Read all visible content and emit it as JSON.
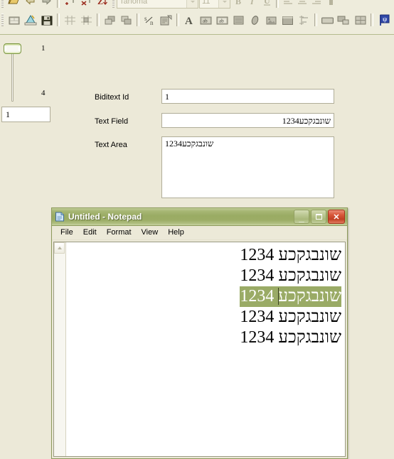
{
  "app_toolbar": {
    "font_name": "Tahoma",
    "font_size": "11",
    "top_row_icons": [
      "open-folder-icon",
      "undo-arrow-icon",
      "redo-arrow-icon",
      "insert-column-icon",
      "remove-column-icon",
      "sort-icon"
    ],
    "main_row_icons": [
      "properties-icon",
      "design-view-icon",
      "save-icon",
      "grid-icon",
      "snap-to-grid-icon",
      "bring-to-front-icon",
      "send-to-back-icon",
      "fraction-icon",
      "edit-mask-icon",
      "font-icon",
      "label-ab-icon",
      "textbox-ab-icon",
      "list-icon",
      "ellipse-icon",
      "image-icon",
      "panel-icon",
      "align-icon",
      "button-icon",
      "combo-icon",
      "table-icon",
      "flag-icon",
      "form-icon"
    ],
    "format_icons": [
      "bold-icon",
      "italic-icon",
      "underline-icon",
      "align-left-icon",
      "align-center-icon",
      "align-right-icon"
    ]
  },
  "designer": {
    "slider": {
      "name": "vertical-slider",
      "tick_top": "1",
      "tick_bottom": "4",
      "value": 1,
      "min": 1,
      "max": 4
    },
    "count_input": {
      "value": "1"
    },
    "fields": [
      {
        "label": "Biditext Id",
        "value": "1",
        "placeholder": ""
      },
      {
        "label": "Text Field",
        "value": "שונבגקכע1234",
        "placeholder": ""
      },
      {
        "label": "Text Area",
        "value": "שונבגקכע1234",
        "placeholder": ""
      }
    ]
  },
  "notepad": {
    "title": "Untitled - Notepad",
    "icon": "notepad-document-icon",
    "window_buttons": {
      "minimize": "_",
      "restore": "❐",
      "close": "✕"
    },
    "menus": [
      "File",
      "Edit",
      "Format",
      "View",
      "Help"
    ],
    "lines": [
      {
        "text": "שונבגקכע 1234",
        "selected": false
      },
      {
        "text": "שונבגקכע 1234",
        "selected": false
      },
      {
        "text": "שונבגקכע 1234",
        "selected": true
      },
      {
        "text": "שונבגקכע 1234",
        "selected": false
      },
      {
        "text": "שונבגקכע 1234",
        "selected": false
      }
    ],
    "selection_color": "#9aab66",
    "scrollbar": {
      "up_arrow": "▲"
    }
  },
  "theme": {
    "window_bg": "#ece9d8",
    "titlebar_olive": "#9aab63",
    "close_red": "#c13f23",
    "accent_green": "#8d9a5b"
  }
}
